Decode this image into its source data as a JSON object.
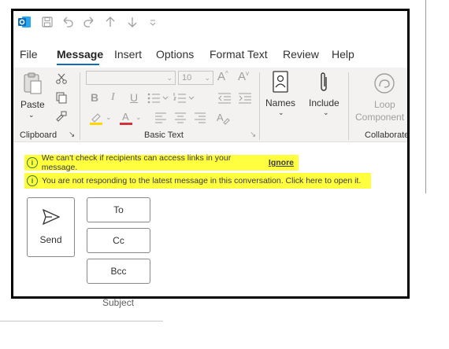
{
  "background": {
    "subject_label": "Subject"
  },
  "qat": {
    "icons": [
      "outlook-icon",
      "save-icon",
      "undo-icon",
      "redo-icon",
      "up-arrow-icon",
      "down-arrow-icon",
      "customize-icon"
    ]
  },
  "menu": {
    "items": [
      "File",
      "Message",
      "Insert",
      "Options",
      "Format Text",
      "Review",
      "Help"
    ],
    "active": "Message"
  },
  "ribbon": {
    "clipboard": {
      "paste_label": "Paste",
      "group_label": "Clipboard"
    },
    "basic_text": {
      "font_name": "",
      "font_size": "10",
      "group_label": "Basic Text"
    },
    "names": {
      "label": "Names"
    },
    "include": {
      "label": "Include"
    },
    "loop": {
      "label_line1": "Loop",
      "label_line2": "Component"
    },
    "collaborate": {
      "group_label": "Collaborate"
    }
  },
  "infobars": [
    {
      "text": "We can't check if recipients can access links in your message.",
      "link": "Ignore"
    },
    {
      "text": "You are not responding to the latest message in this conversation. Click here to open it."
    }
  ],
  "compose": {
    "send_label": "Send",
    "to_label": "To",
    "cc_label": "Cc",
    "bcc_label": "Bcc"
  },
  "colors": {
    "highlight": "#ffff3f",
    "accent": "#0f6cbd",
    "info_icon": "#3a7a2f",
    "highlighter_pen": "#ffd700",
    "font_color_bar": "#d13438"
  }
}
